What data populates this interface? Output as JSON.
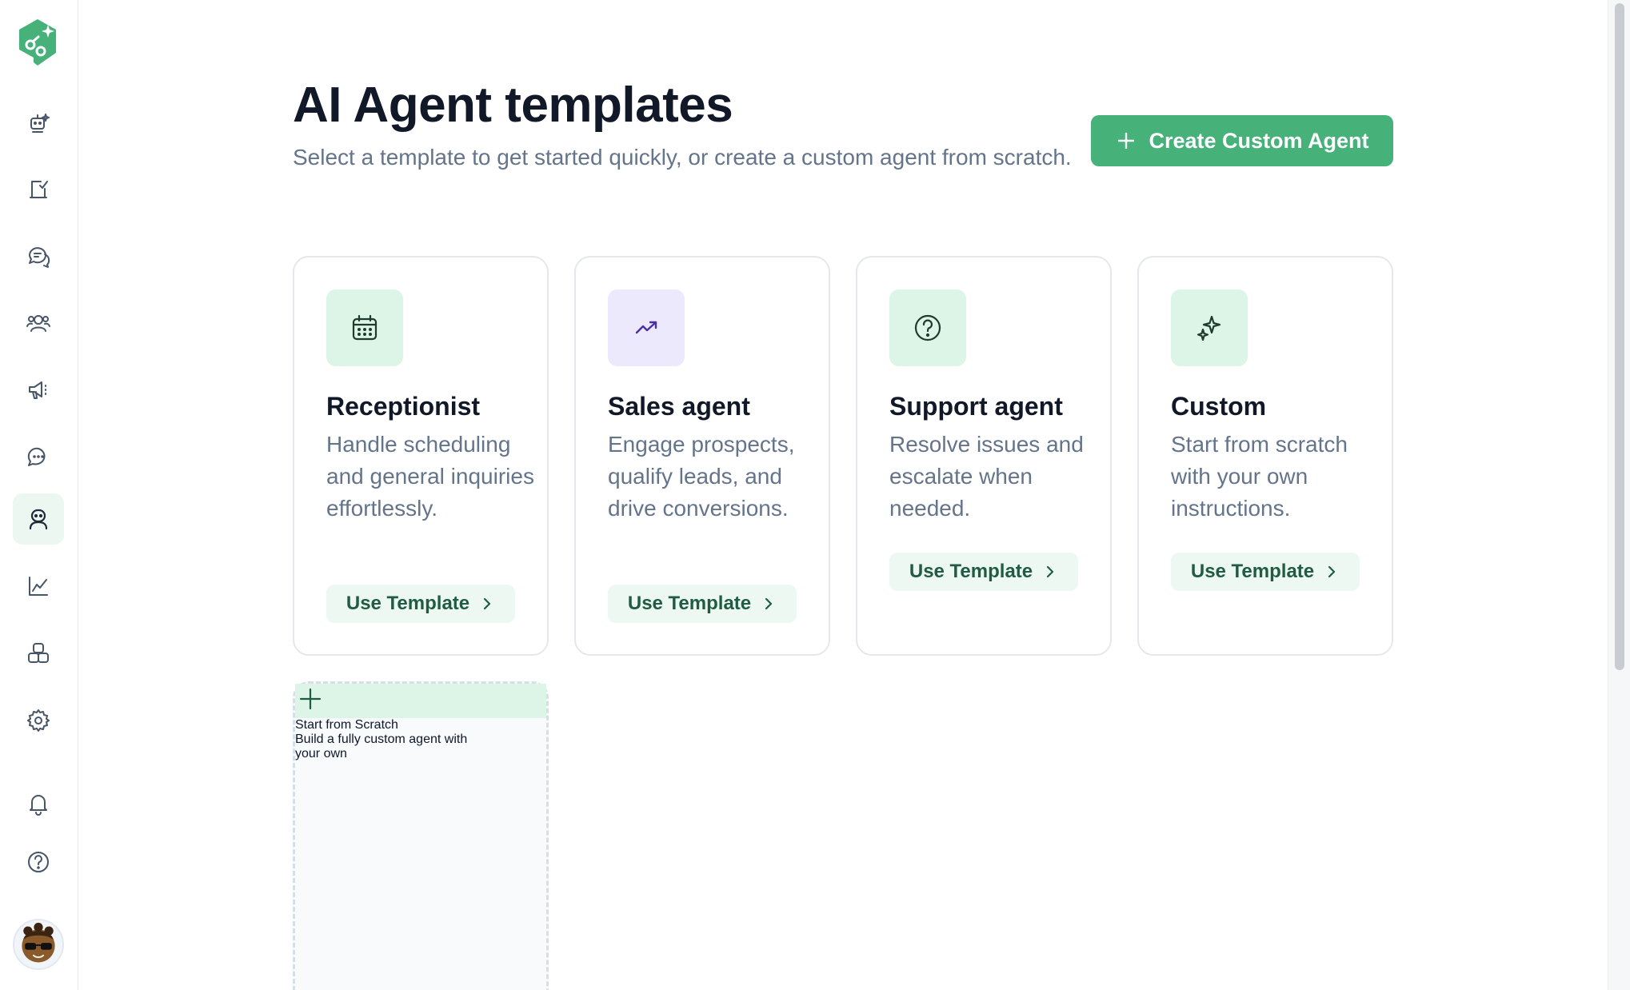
{
  "header": {
    "title": "AI Agent templates",
    "subtitle": "Select a template to get started quickly, or create a custom agent from scratch.",
    "create_button_label": "Create Custom Agent"
  },
  "templates": [
    {
      "title": "Receptionist",
      "description": "Handle scheduling and general inquiries effortlessly.",
      "button_label": "Use Template",
      "icon": "calendar-icon",
      "icon_bg": "#dcf5e7"
    },
    {
      "title": "Sales agent",
      "description": "Engage prospects, qualify leads, and drive conversions.",
      "button_label": "Use Template",
      "icon": "trending-up-icon",
      "icon_bg": "#ece9fd"
    },
    {
      "title": "Support agent",
      "description": "Resolve issues and escalate when needed.",
      "button_label": "Use Template",
      "icon": "help-circle-icon",
      "icon_bg": "#dcf5e7"
    },
    {
      "title": "Custom",
      "description": "Start from scratch with your own instructions.",
      "button_label": "Use Template",
      "icon": "sparkles-icon",
      "icon_bg": "#dcf5e7"
    }
  ],
  "scratch_card": {
    "title": "Start from Scratch",
    "description": "Build a fully custom agent with your own",
    "icon": "plus-icon"
  },
  "sidebar": {
    "items": [
      "robot-sparkle-icon",
      "clipboard-check-icon",
      "chat-bubbles-icon",
      "users-icon",
      "megaphone-icon",
      "message-dots-icon",
      "agent-icon",
      "chart-line-icon",
      "integrations-icon",
      "settings-icon",
      "bell-icon",
      "help-icon"
    ],
    "active_item": "agent-icon"
  },
  "colors": {
    "accent": "#46b27a",
    "accent_soft": "#ecf8f1",
    "text_muted": "#64748b"
  }
}
